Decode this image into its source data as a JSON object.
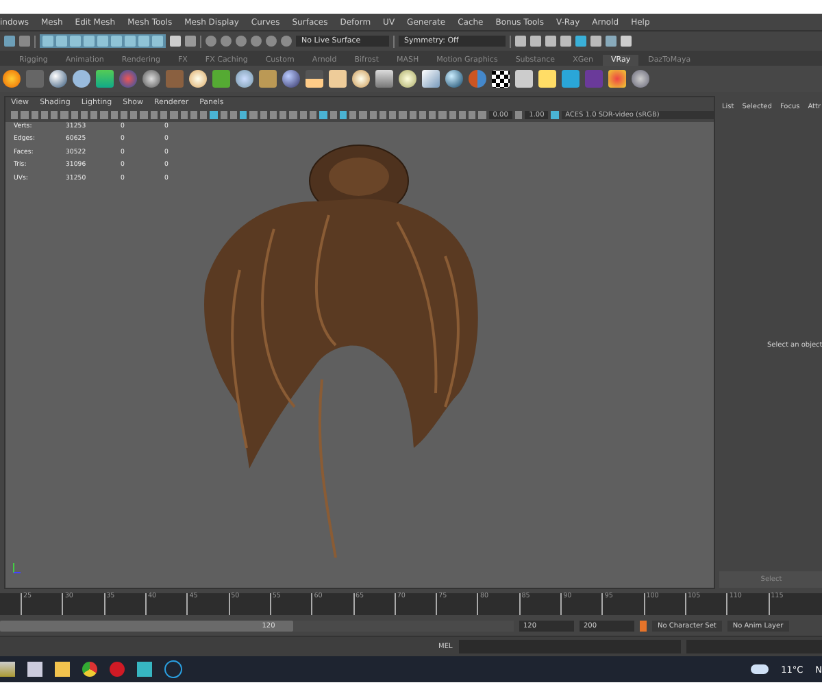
{
  "menu_bar": {
    "items": [
      "indows",
      "Mesh",
      "Edit Mesh",
      "Mesh Tools",
      "Mesh Display",
      "Curves",
      "Surfaces",
      "Deform",
      "UV",
      "Generate",
      "Cache",
      "Bonus Tools",
      "V-Ray",
      "Arnold",
      "Help"
    ]
  },
  "status_line": {
    "live_surface": "No Live Surface",
    "symmetry": "Symmetry: Off"
  },
  "shelf_tabs": [
    {
      "label": "Rigging",
      "selected": false
    },
    {
      "label": "Animation",
      "selected": false
    },
    {
      "label": "Rendering",
      "selected": false
    },
    {
      "label": "FX",
      "selected": false
    },
    {
      "label": "FX Caching",
      "selected": false
    },
    {
      "label": "Custom",
      "selected": false
    },
    {
      "label": "Arnold",
      "selected": false
    },
    {
      "label": "Bifrost",
      "selected": false
    },
    {
      "label": "MASH",
      "selected": false
    },
    {
      "label": "Motion Graphics",
      "selected": false
    },
    {
      "label": "Substance",
      "selected": false
    },
    {
      "label": "XGen",
      "selected": false
    },
    {
      "label": "VRay",
      "selected": true
    },
    {
      "label": "DazToMaya",
      "selected": false
    }
  ],
  "viewport": {
    "menu": [
      "View",
      "Shading",
      "Lighting",
      "Show",
      "Renderer",
      "Panels"
    ],
    "exposure": "0.00",
    "gamma": "1.00",
    "color_space": "ACES 1.0 SDR-video (sRGB)",
    "hud": [
      {
        "label": "Verts:",
        "values": [
          "31253",
          "0",
          "0"
        ]
      },
      {
        "label": "Edges:",
        "values": [
          "60625",
          "0",
          "0"
        ]
      },
      {
        "label": "Faces:",
        "values": [
          "30522",
          "0",
          "0"
        ]
      },
      {
        "label": "Tris:",
        "values": [
          "31096",
          "0",
          "0"
        ]
      },
      {
        "label": "UVs:",
        "values": [
          "31250",
          "0",
          "0"
        ]
      }
    ]
  },
  "side_panel": {
    "tabs": [
      "List",
      "Selected",
      "Focus",
      "Attr"
    ],
    "message": "Select an object",
    "button": "Select"
  },
  "timeline": {
    "ticks": [
      "25",
      "30",
      "35",
      "40",
      "45",
      "50",
      "55",
      "60",
      "65",
      "70",
      "75",
      "80",
      "85",
      "90",
      "95",
      "100",
      "105",
      "110",
      "115"
    ]
  },
  "range": {
    "current": "120",
    "level": 0.57,
    "end": "120",
    "max": "200",
    "character_set": "No Character Set",
    "anim_layer": "No Anim Layer"
  },
  "command_line": {
    "language": "MEL"
  },
  "taskbar": {
    "temperature": "11°C",
    "cut_text": "N"
  }
}
